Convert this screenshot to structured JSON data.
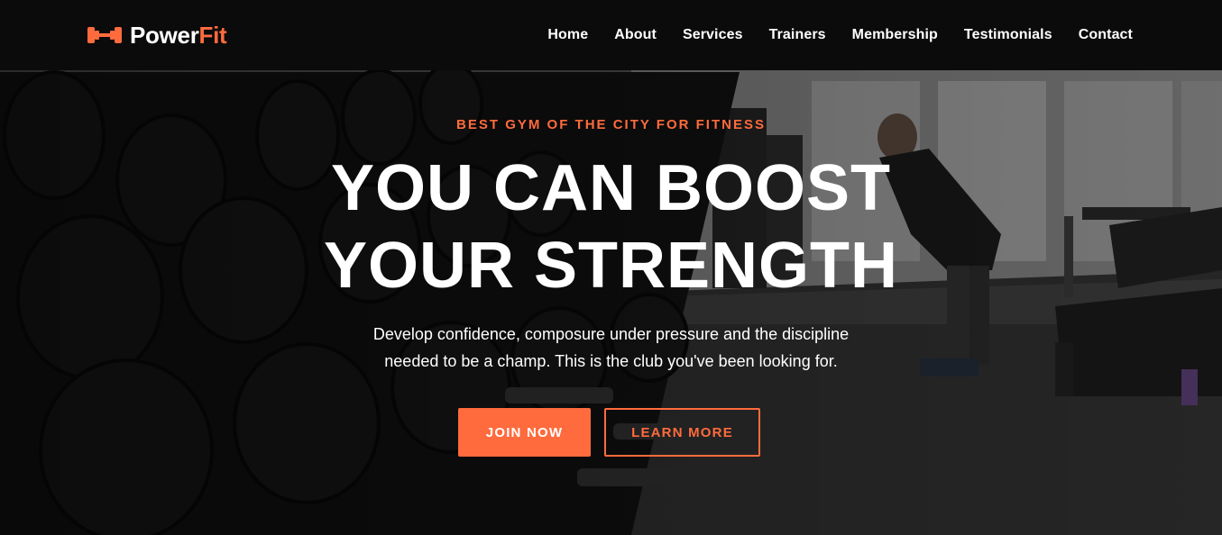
{
  "brand": {
    "name_part1": "Power",
    "name_part2": "Fit",
    "logo_icon": "dumbbell-icon",
    "accent_color": "#ff6b3d"
  },
  "nav": {
    "items": [
      {
        "label": "Home"
      },
      {
        "label": "About"
      },
      {
        "label": "Services"
      },
      {
        "label": "Trainers"
      },
      {
        "label": "Membership"
      },
      {
        "label": "Testimonials"
      },
      {
        "label": "Contact"
      }
    ]
  },
  "hero": {
    "eyebrow": "BEST GYM OF THE CITY FOR FITNESS",
    "headline_line1": "YOU CAN BOOST",
    "headline_line2": "YOUR STRENGTH",
    "sub_line1": "Develop confidence, composure under pressure and the discipline",
    "sub_line2": "needed to be a champ. This is the club you've been looking for.",
    "primary_cta": "JOIN NOW",
    "secondary_cta": "LEARN MORE"
  },
  "colors": {
    "accent": "#ff6b3d",
    "navbar_bg": "#0b0b0b",
    "text": "#ffffff"
  }
}
